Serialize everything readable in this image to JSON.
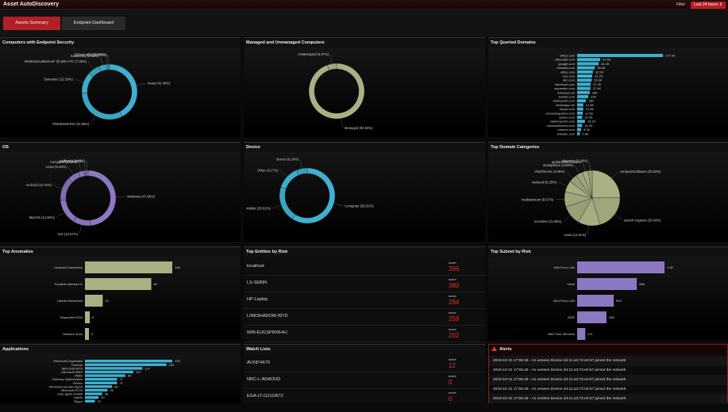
{
  "header": {
    "title": "Asset AutoDiscovery",
    "filter_label": "Filter",
    "range": "Last 24 hours ⇕"
  },
  "tabs": [
    {
      "label": "Assets Summary"
    },
    {
      "label": "Endpoint Dashboard"
    }
  ],
  "panels": {
    "endpoint_security": {
      "title": "Computers with Endpoint Security"
    },
    "managed": {
      "title": "Managed and Unmanaged Computers"
    },
    "top_domains": {
      "title": "Top Queried Domains"
    },
    "os": {
      "title": "OS"
    },
    "device": {
      "title": "Device"
    },
    "domain_categories": {
      "title": "Top Domain Categories"
    },
    "anomalies": {
      "title": "Top Anomalies"
    },
    "entities": {
      "title": "Top Entities by Risk",
      "score_label": "score",
      "rows": [
        {
          "name": "localhost",
          "score": "396"
        },
        {
          "name": "LS-SEBIN",
          "score": "380"
        },
        {
          "name": "HP-Laptop",
          "score": "284"
        },
        {
          "name": "LINKSHADOW-WYD",
          "score": "259"
        },
        {
          "name": "WIN-EUGSPIKRH4J",
          "score": "202"
        }
      ]
    },
    "subnet": {
      "title": "Top Subnet by Risk"
    },
    "applications": {
      "title": "Applications"
    },
    "watch": {
      "title": "Watch Lists",
      "score_label": "score",
      "rows": [
        {
          "name": "AVX874679",
          "score": "12"
        },
        {
          "name": "NRC-L-ADAOUD",
          "score": "0"
        },
        {
          "name": "EGA-LT-G21GR72",
          "score": "0"
        }
      ]
    },
    "alerts": {
      "title": "Alerts",
      "icon": "warning-icon",
      "rows": [
        "2019-10-31 17:55:46 - An unseen Device d4:11:a3:72:e0:57 joined the network",
        "2019-10-31 17:55:46 - An unseen Device d4:11:a3:72:e0:57 joined the network",
        "2019-10-31 17:55:46 - An unseen Device d4:11:a3:72:e0:57 joined the network",
        "2019-10-31 17:55:46 - An unseen Device d4:11:a3:72:e0:57 joined the network",
        "2019-10-31 17:55:46 - An unseen Device d4:11:a3:72:e0:57 joined the network"
      ]
    }
  },
  "chart_data": [
    {
      "id": "endpoint_security",
      "type": "pie",
      "color": "#3fb0cf",
      "slices": [
        {
          "label": "Avast (42.46%)",
          "value": 42.46
        },
        {
          "label": "TRENDMICRO (31.86%)",
          "value": 31.86
        },
        {
          "label": "Symantec (12.39%)",
          "value": 12.39
        },
        {
          "label": "WindowsAuditServer @ IDEA-PC (7.08%)",
          "value": 7.08
        },
        {
          "label": "Kaspersky (4.42%)",
          "value": 4.42
        },
        {
          "label": "BitDefender (0.88%)",
          "value": 0.88
        },
        {
          "label": "ELEI (0.88%)",
          "value": 0.88
        }
      ]
    },
    {
      "id": "managed",
      "type": "pie",
      "color": "#a9b184",
      "slices": [
        {
          "label": "Managed (94.63%)",
          "value": 94.63
        },
        {
          "label": "UnManaged (5.37%)",
          "value": 5.37
        }
      ]
    },
    {
      "id": "top_domains",
      "type": "bar",
      "orientation": "horizontal",
      "color": "#3fb0cf",
      "categories": [
        "wlbsz.com",
        "office365.com",
        "google.com",
        "netsuite.com",
        "office.com",
        "live.com",
        "abc.com",
        "facebook.com",
        "symantec.com",
        "windows.net",
        "lanelet.com",
        "sharepoint.com",
        "whatsapp.net",
        "skype.com",
        "servicesapplers.com",
        "yahoo.com",
        "claimexperts.com",
        "microsoftonline.com",
        "cdance.com",
        "linkedin.com"
      ],
      "values": [
        177.2,
        47.6,
        44.4,
        36.5,
        32.5,
        31.2,
        29.9,
        27.9,
        27.4,
        26,
        23,
        18,
        12.6,
        12.6,
        11.5,
        10.2,
        16.1,
        10.2,
        8.3,
        5.6
      ],
      "value_labels": [
        "177.2K",
        "47.6K",
        "44.4K",
        "36.5K",
        "32.5K",
        "31.2K",
        "29.9K",
        "27.9K",
        "27.4K",
        "26K",
        "23K",
        "18K",
        "12.6K",
        "12.6K",
        "11.5K",
        "10.2K",
        "16.1K",
        "10.2K",
        "8.3K",
        "5.6K"
      ]
    },
    {
      "id": "os",
      "type": "pie",
      "color": "#8c78c2",
      "slices": [
        {
          "label": "Windows (47.66%)",
          "value": 47.66
        },
        {
          "label": "iOS (10.07%)",
          "value": 10.07
        },
        {
          "label": "MacOS (14.38%)",
          "value": 14.38
        },
        {
          "label": "Android (13.75%)",
          "value": 13.75
        },
        {
          "label": "Linux (6.45%)",
          "value": 6.45
        },
        {
          "label": "Computer (3.22%)",
          "value": 3.22
        },
        {
          "label": "Debian (1.29%)",
          "value": 1.29
        },
        {
          "label": "Ubuntu (1.09%)",
          "value": 1.09
        }
      ]
    },
    {
      "id": "device",
      "type": "pie",
      "color": "#3fb0cf",
      "slices": [
        {
          "label": "Computer (58.32%)",
          "value": 58.32
        },
        {
          "label": "Mobile (20.82%)",
          "value": 20.82
        },
        {
          "label": "Other (13.7%)",
          "value": 13.7
        },
        {
          "label": "Server (6.14%)",
          "value": 6.14
        }
      ]
    },
    {
      "id": "domain_categories",
      "type": "pie",
      "color": "#a9b184",
      "slices": [
        {
          "label": "computersoftware (23.93%)",
          "value": 23.93
        },
        {
          "label": "search engines (20.04%)",
          "value": 20.04
        },
        {
          "label": "news (12.61%)",
          "value": 12.61
        },
        {
          "label": "socialnet (11.06%)",
          "value": 11.06
        },
        {
          "label": "mediastream (8.57%)",
          "value": 8.57
        },
        {
          "label": "webmail (6.25%)",
          "value": 6.25
        },
        {
          "label": "chat/forums (4.85%)",
          "value": 4.85
        },
        {
          "label": "smartphone (3.89%)",
          "value": 3.89
        },
        {
          "label": "updatesites (3.25%)",
          "value": 3.25
        },
        {
          "label": "shopping (2.34%)",
          "value": 2.34
        }
      ]
    },
    {
      "id": "anomalies",
      "type": "bar",
      "orientation": "horizontal",
      "color": "#a9b184",
      "categories": [
        "Unusual Connection",
        "Possible Malware D",
        "Lateral Movement",
        "Suspected DGA",
        "Network Scan"
      ],
      "values": [
        108,
        82,
        22,
        6,
        5
      ]
    },
    {
      "id": "subnet",
      "type": "bar",
      "orientation": "horizontal",
      "color": "#8c78c2",
      "categories": [
        "16th Floor LAN",
        "Voice",
        "43rd Floor LAN",
        "DMZ",
        "36th Floor Wireless"
      ],
      "values": [
        1300,
        888,
        544,
        436,
        121
      ],
      "value_labels": [
        "1.3K",
        "888",
        "544",
        "436",
        "121"
      ]
    },
    {
      "id": "applications",
      "type": "bar",
      "orientation": "horizontal",
      "color": "#3fb0cf",
      "categories": [
        "Microsoft-Cryptoskin",
        "Chrome",
        "Microsoft BITS",
        "Microsoft WNS",
        "MSIE",
        "Delivery-Optimization",
        "Firefox",
        "Windows-Update-Agent",
        "Microsoft NCSI",
        "ocsp.apple.invalid",
        "Dalvik",
        "Skype"
      ],
      "values": [
        193,
        180,
        127,
        107,
        89,
        71,
        71,
        60,
        50,
        38,
        30,
        22
      ]
    }
  ]
}
